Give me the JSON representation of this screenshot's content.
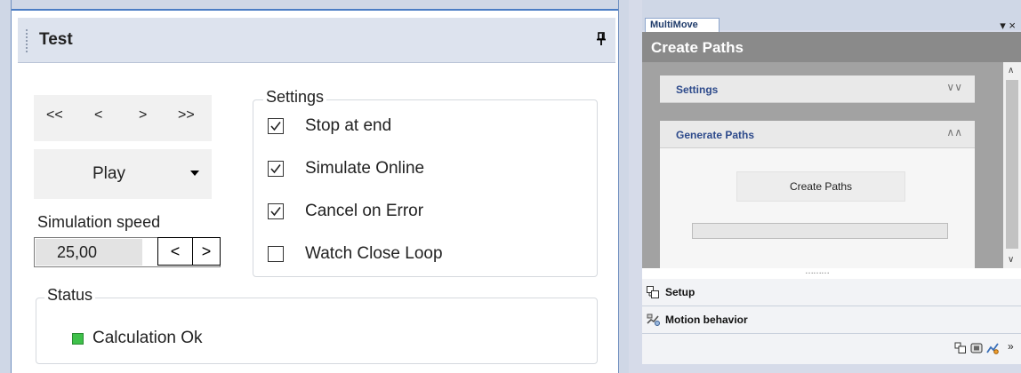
{
  "test_panel": {
    "title": "Test",
    "step_buttons": [
      "<<",
      "<",
      ">",
      ">>"
    ],
    "play_label": "Play",
    "speed_label": "Simulation speed",
    "speed_value": "25,00",
    "speed_dec": "<",
    "speed_inc": ">",
    "settings": {
      "legend": "Settings",
      "options": [
        {
          "label": "Stop at end",
          "checked": true
        },
        {
          "label": "Simulate Online",
          "checked": true
        },
        {
          "label": "Cancel on Error",
          "checked": true
        },
        {
          "label": "Watch Close Loop",
          "checked": false
        }
      ]
    },
    "status": {
      "legend": "Status",
      "text": "Calculation Ok",
      "led_color": "#3fc14a"
    }
  },
  "multimove": {
    "tab_label": "MultiMove",
    "window_controls": "▾ ×",
    "header_title": "Create Paths",
    "sections": {
      "settings_label": "Settings",
      "generate_label": "Generate Paths"
    },
    "create_button": "Create Paths",
    "progress": 0,
    "nav": {
      "setup": "Setup",
      "motion": "Motion behavior"
    },
    "toolbar_icons": [
      "setup-icon",
      "stop-icon",
      "motion-icon"
    ],
    "overflow_chevron": "»"
  }
}
